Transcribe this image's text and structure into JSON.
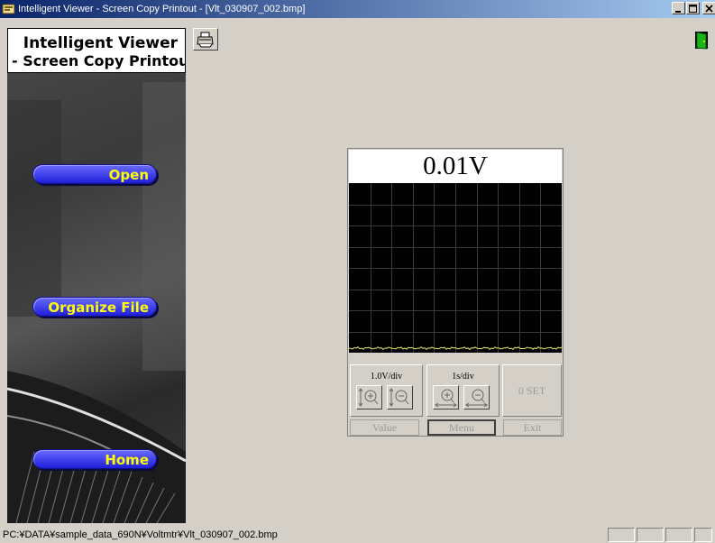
{
  "window": {
    "title": "Intelligent Viewer - Screen Copy Printout - [Vlt_030907_002.bmp]",
    "app_icon": "app-icon",
    "controls": [
      "minimize-icon",
      "maximize-icon",
      "close-icon"
    ]
  },
  "logo": {
    "line1": "Intelligent Viewer",
    "line2": "- Screen Copy Printout -"
  },
  "nav": {
    "open": "Open",
    "organize": "Organize File",
    "home": "Home"
  },
  "toolbar": {
    "print_icon": "printer-icon",
    "exit_icon": "exit-door-icon"
  },
  "device": {
    "reading": "0.01V",
    "volt_div": "1.0V/div",
    "time_div": "1s/div",
    "zero_set": "0 SET",
    "value": "Value",
    "menu": "Menu",
    "exit": "Exit"
  },
  "status": {
    "path": "PC:¥DATA¥sample_data_690N¥Voltmtr¥Vlt_030907_002.bmp"
  },
  "colors": {
    "title_bar": "#0a246a",
    "nav_button": "#3c3cf0",
    "nav_text": "#ffff00",
    "scope_bg": "#000000",
    "scope_grid": "#3a3a3a",
    "trace": "#e8e86a"
  }
}
